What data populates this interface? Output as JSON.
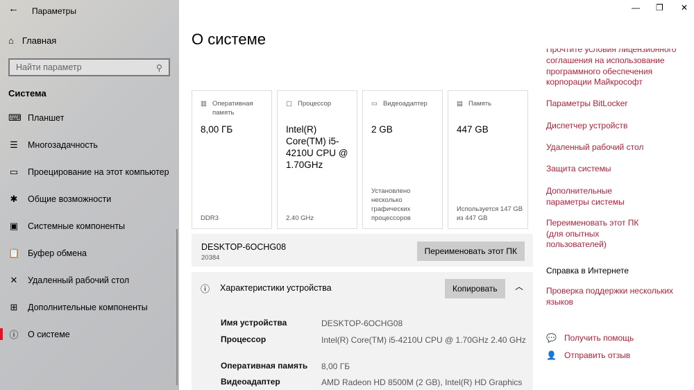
{
  "sidebar": {
    "back": "←",
    "title": "Параметры",
    "home": "Главная",
    "search_placeholder": "Найти параметр",
    "section": "Система",
    "items": [
      {
        "icon": "⌨",
        "label": "Планшет"
      },
      {
        "icon": "☰",
        "label": "Многозадачность"
      },
      {
        "icon": "▭",
        "label": "Проецирование на этот компьютер"
      },
      {
        "icon": "✱",
        "label": "Общие возможности"
      },
      {
        "icon": "▣",
        "label": "Системные компоненты"
      },
      {
        "icon": "📋",
        "label": "Буфер обмена"
      },
      {
        "icon": "✕",
        "label": "Удаленный рабочий стол"
      },
      {
        "icon": "⊞",
        "label": "Дополнительные компоненты"
      },
      {
        "icon": "ⓘ",
        "label": "О системе"
      }
    ]
  },
  "window": {
    "min": "—",
    "max": "❐",
    "close": "✕"
  },
  "main": {
    "title": "О системе",
    "cards": [
      {
        "label": "Оперативная память",
        "value": "8,00 ГБ",
        "footer": "DDR3"
      },
      {
        "label": "Процессор",
        "value": "Intel(R) Core(TM) i5-4210U CPU @ 1.70GHz",
        "footer": "2.40 GHz"
      },
      {
        "label": "Видеоадаптер",
        "value": "2 GB",
        "footer": "Установлено несколько графических процессоров"
      },
      {
        "label": "Память",
        "value": "447 GB",
        "footer": "Используется 147 GB из 447 GB"
      }
    ],
    "pc_name": "DESKTOP-6OCHG08",
    "pc_sub": "20384",
    "rename": "Переименовать этот ПК",
    "specs_title": "Характеристики устройства",
    "copy": "Копировать",
    "specs": [
      {
        "k": "Имя устройства",
        "v": "DESKTOP-6OCHG08"
      },
      {
        "k": "Процессор",
        "v": "Intel(R)  Core(TM)  i5-4210U  CPU  @  1.70GHz     2.40 GHz"
      },
      {
        "k": "Оперативная память",
        "v": "8,00 ГБ"
      },
      {
        "k": "Видеоадаптер",
        "v": "AMD Radeon HD 8500M (2 GB), Intel(R) HD Graphics"
      }
    ]
  },
  "related": {
    "license": "соглашения на использование программного обеспечения корпорации Майкрософт",
    "links": [
      "Параметры BitLocker",
      "Диспетчер устройств",
      "Удаленный рабочий стол",
      "Защита системы",
      "Дополнительные параметры системы",
      "Переименовать этот ПК (для опытных пользователей)"
    ],
    "help_title": "Справка в Интернете",
    "help_link": "Проверка поддержки нескольких языков",
    "get_help": "Получить помощь",
    "feedback": "Отправить отзыв"
  }
}
